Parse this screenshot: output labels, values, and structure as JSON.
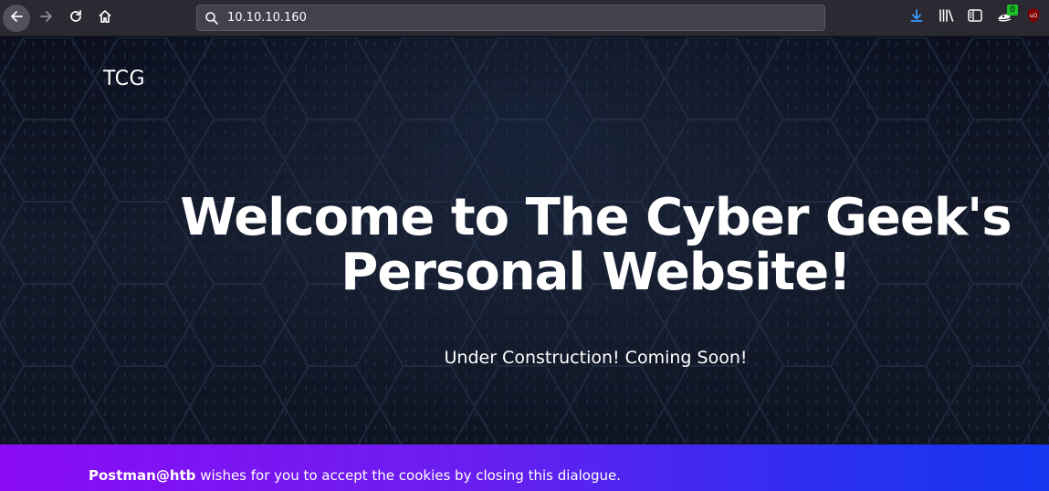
{
  "browser": {
    "url": "10.10.10.160",
    "icons": {
      "back": "back-arrow-icon",
      "forward": "forward-arrow-icon",
      "reload": "reload-icon",
      "home": "home-icon",
      "search": "search-icon",
      "download": "download-icon",
      "library": "library-icon",
      "sidebar": "sidebar-icon",
      "extension": "extension-icon",
      "ublock": "ublock-icon"
    },
    "extension_badge": "0"
  },
  "site": {
    "brand": "TCG",
    "hero_title_line1": "Welcome to The Cyber Geek's",
    "hero_title_line2": "Personal Website!",
    "hero_subtitle": "Under Construction! Coming Soon!"
  },
  "cookie_banner": {
    "sender": "Postman@htb",
    "message": " wishes for you to accept the cookies by closing this dialogue."
  },
  "colors": {
    "toolbar": "#2b2a33",
    "cookie_start": "#8a0cf5",
    "cookie_end": "#1536f0",
    "download_accent": "#3a9cff",
    "badge": "#1dbf29",
    "ublock_red": "#800000"
  }
}
